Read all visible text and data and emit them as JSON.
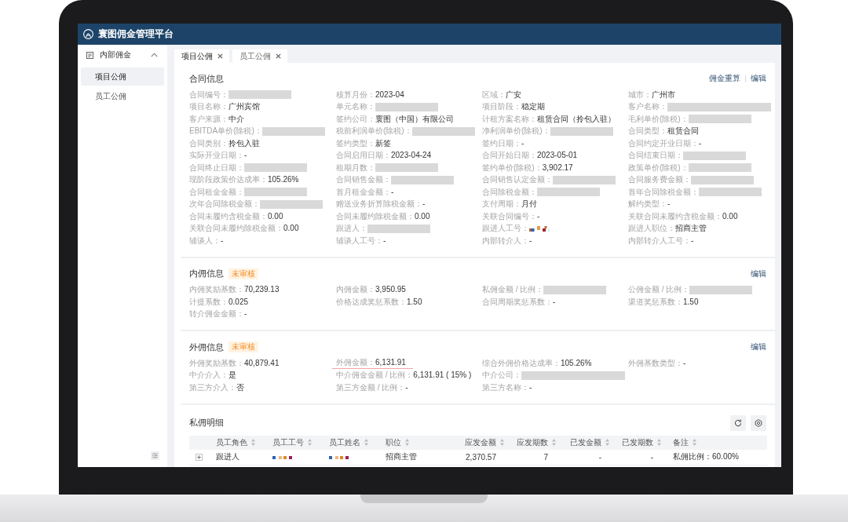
{
  "app": {
    "title": "寰图佣金管理平台"
  },
  "sidebar": {
    "groups": [
      {
        "label": "内部佣金",
        "expanded": true,
        "children": [
          {
            "label": "项目公佣",
            "selected": true
          },
          {
            "label": "员工公佣",
            "selected": false
          }
        ]
      }
    ]
  },
  "tabs": [
    {
      "label": "项目公佣",
      "selected": true
    },
    {
      "label": "员工公佣",
      "selected": false
    }
  ],
  "sections": [
    {
      "title": "合同信息",
      "actions": [
        "佣金重算",
        "编辑"
      ],
      "rows": [
        [
          {
            "kind": "masked",
            "label": "合同编号："
          },
          {
            "kind": "text",
            "label": "核算月份：",
            "value": "2023-04"
          },
          {
            "kind": "text",
            "label": "区域：",
            "value": "广安"
          },
          {
            "kind": "text",
            "label": "城市：",
            "value": "广州市"
          }
        ],
        [
          {
            "kind": "text",
            "label": "项目名称：",
            "value": "广州宾馆"
          },
          {
            "kind": "masked",
            "label": "单元名称："
          },
          {
            "kind": "text",
            "label": "项目阶段：",
            "value": "稳定期"
          },
          {
            "kind": "widemasked",
            "label": "客户名称："
          }
        ],
        [
          {
            "kind": "text",
            "label": "客户来源：",
            "value": "中介"
          },
          {
            "kind": "text",
            "label": "签约公司：",
            "value": "寰图（中国）有限公司"
          },
          {
            "kind": "text",
            "label": "计租方案名称：",
            "value": "租赁合同（拎包入驻）"
          },
          {
            "kind": "masked",
            "label": "毛利单价(除税)："
          }
        ],
        [
          {
            "kind": "masked",
            "label": "EBITDA单价(除税)："
          },
          {
            "kind": "masked",
            "label": "税前利润单价(除税)："
          },
          {
            "kind": "masked",
            "label": "净利润单价(除税)："
          },
          {
            "kind": "text",
            "label": "合同类型：",
            "value": "租赁合同"
          }
        ],
        [
          {
            "kind": "text",
            "label": "合同类别：",
            "value": "拎包入驻"
          },
          {
            "kind": "text",
            "label": "签约类型：",
            "value": "新签"
          },
          {
            "kind": "text",
            "label": "签约日期：",
            "value": "-"
          },
          {
            "kind": "text",
            "label": "合同约定开业日期：",
            "value": "-"
          }
        ],
        [
          {
            "kind": "text",
            "label": "实际开业日期：",
            "value": "-"
          },
          {
            "kind": "text",
            "label": "合同启用日期：",
            "value": "2023-04-24"
          },
          {
            "kind": "text",
            "label": "合同开始日期：",
            "value": "2023-05-01"
          },
          {
            "kind": "masked",
            "label": "合同结束日期："
          }
        ],
        [
          {
            "kind": "masked",
            "label": "合同终止日期："
          },
          {
            "kind": "masked",
            "label": "租期月数："
          },
          {
            "kind": "text",
            "label": "签约单价(除税)：",
            "value": "3,902.17"
          },
          {
            "kind": "masked",
            "label": "政策单价(除税)："
          }
        ],
        [
          {
            "kind": "text",
            "label": "现阶段政策价达成率：",
            "value": "105.26%"
          },
          {
            "kind": "masked",
            "label": "合同销售金额："
          },
          {
            "kind": "masked",
            "label": "合同销售认定金额："
          },
          {
            "kind": "masked",
            "label": "合同服务费金额："
          }
        ],
        [
          {
            "kind": "masked",
            "label": "合同租金金额："
          },
          {
            "kind": "text",
            "label": "首月租金金额：",
            "value": "-"
          },
          {
            "kind": "masked",
            "label": "合同除税金额："
          },
          {
            "kind": "masked",
            "label": "首年合同除税金额："
          }
        ],
        [
          {
            "kind": "masked",
            "label": "次年合同除税金额："
          },
          {
            "kind": "text",
            "label": "赠送业务折算除税金额：",
            "value": "-"
          },
          {
            "kind": "text",
            "label": "支付周期：",
            "value": "月付"
          },
          {
            "kind": "text",
            "label": "解约类型：",
            "value": "-"
          }
        ],
        [
          {
            "kind": "text",
            "label": "合同未履约含税金额：",
            "value": "0.00"
          },
          {
            "kind": "text",
            "label": "合同未履约除税金额：",
            "value": "0.00"
          },
          {
            "kind": "text",
            "label": "关联合同编号：",
            "value": "-"
          },
          {
            "kind": "text",
            "label": "关联合同未履约含税金额：",
            "value": "0.00"
          }
        ],
        [
          {
            "kind": "text",
            "label": "关联合同未履约除税金额：",
            "value": "0.00"
          },
          {
            "kind": "masked",
            "label": "跟进人："
          },
          {
            "kind": "mosaic",
            "label": "跟进人工号："
          },
          {
            "kind": "text",
            "label": "跟进人职位：",
            "value": "招商主管"
          }
        ],
        [
          {
            "kind": "text",
            "label": "辅谈人：",
            "value": "-"
          },
          {
            "kind": "text",
            "label": "辅谈人工号：",
            "value": "-"
          },
          {
            "kind": "text",
            "label": "内部转介人：",
            "value": "-"
          },
          {
            "kind": "text",
            "label": "内部转介人工号：",
            "value": "-"
          }
        ]
      ]
    },
    {
      "title": "内佣信息",
      "badge": "未审核",
      "actions": [
        "编辑"
      ],
      "rows": [
        [
          {
            "kind": "text",
            "label": "内佣奖励基数：",
            "value": "70,239.13"
          },
          {
            "kind": "text",
            "label": "内佣金额：",
            "value": "3,950.95"
          },
          {
            "kind": "masked",
            "label": "私佣金额 / 比例："
          },
          {
            "kind": "masked",
            "label": "公佣金额 / 比例："
          }
        ],
        [
          {
            "kind": "text",
            "label": "计提系数：",
            "value": "0.025"
          },
          {
            "kind": "text",
            "label": "价格达成奖惩系数：",
            "value": "1.50"
          },
          {
            "kind": "text",
            "label": "合同周期奖惩系数：",
            "value": "-"
          },
          {
            "kind": "text",
            "label": "渠道奖惩系数：",
            "value": "1.50"
          }
        ],
        [
          {
            "kind": "text",
            "label": "转介佣金金额：",
            "value": "-"
          }
        ]
      ]
    },
    {
      "title": "外佣信息",
      "badge": "未审核",
      "actions": [
        "编辑"
      ],
      "rows": [
        [
          {
            "kind": "text",
            "label": "外佣奖励基数：",
            "value": "40,879.41"
          },
          {
            "kind": "text",
            "label": "外佣金额：",
            "value": "6,131.91",
            "underlined": true
          },
          {
            "kind": "text",
            "label": "综合外佣价格达成率：",
            "value": "105.26%"
          },
          {
            "kind": "text",
            "label": "外佣基数类型：",
            "value": "-"
          }
        ],
        [
          {
            "kind": "text",
            "label": "中介介入：",
            "value": "是"
          },
          {
            "kind": "text",
            "label": "中介佣金金额 / 比例：",
            "value": "6,131.91 ( 15% )"
          },
          {
            "kind": "widemasked",
            "label": "中介公司："
          }
        ],
        [
          {
            "kind": "text",
            "label": "第三方介入：",
            "value": "否"
          },
          {
            "kind": "text",
            "label": "第三方金额 / 比例：",
            "value": "-"
          },
          {
            "kind": "text",
            "label": "第三方名称：",
            "value": "-"
          }
        ]
      ]
    }
  ],
  "detail": {
    "title": "私佣明细",
    "columns": [
      {
        "label": "员工角色",
        "kind": "text"
      },
      {
        "label": "员工工号",
        "kind": "text"
      },
      {
        "label": "员工姓名",
        "kind": "text"
      },
      {
        "label": "职位",
        "kind": "text"
      },
      {
        "label": "应发金额",
        "kind": "number"
      },
      {
        "label": "应发期数",
        "kind": "number"
      },
      {
        "label": "已发金额",
        "kind": "number"
      },
      {
        "label": "已发期数",
        "kind": "number"
      },
      {
        "label": "备注",
        "kind": "text"
      }
    ],
    "rows": [
      {
        "expanded": false,
        "cells": [
          {
            "kind": "text",
            "value": "跟进人"
          },
          {
            "kind": "mosaic"
          },
          {
            "kind": "mosaic"
          },
          {
            "kind": "text",
            "value": "招商主管"
          },
          {
            "kind": "text",
            "value": "2,370.57"
          },
          {
            "kind": "text",
            "value": "7"
          },
          {
            "kind": "text",
            "value": "-"
          },
          {
            "kind": "text",
            "value": "-"
          },
          {
            "kind": "text",
            "value": "私佣比例：60.00%"
          }
        ]
      }
    ]
  }
}
